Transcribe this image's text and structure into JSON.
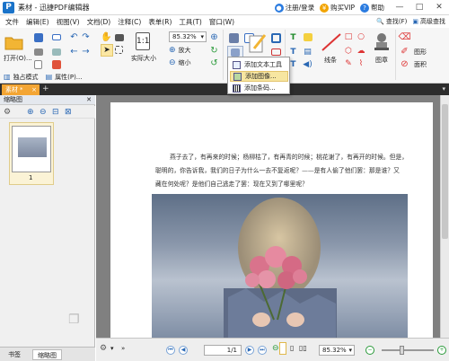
{
  "window": {
    "title": "素材 - 迅捷PDF编辑器",
    "logo_letter": "P"
  },
  "title_right": {
    "login": "注册/登录",
    "vip": "购买VIP",
    "help": "帮助",
    "colors": {
      "login": "#2a7be0",
      "vip": "#f2a400",
      "help": "#2a7be0"
    }
  },
  "menu": [
    "文件",
    "编辑(E)",
    "视图(V)",
    "文档(D)",
    "注释(C)",
    "表单(R)",
    "工具(T)",
    "窗口(W)"
  ],
  "menu_right": {
    "find": "查找(F)",
    "advanced_search": "高级查找"
  },
  "toolbar": {
    "open": "打开(O)...",
    "actual_size": "实际大小",
    "zoom_value": "85.32%",
    "zoom_in": "放大",
    "zoom_out": "缩小",
    "stamp": "图章",
    "line": "线条",
    "right_a": "图形",
    "right_b": "面积"
  },
  "subbar": {
    "exclusive_mode": "独占模式",
    "properties": "属性(P)..."
  },
  "dropdown": {
    "items": [
      "添加文本工具",
      "添加图像...",
      "添加条码..."
    ],
    "selected_index": 1
  },
  "tab": {
    "label": "素材",
    "close": "×"
  },
  "left_panel": {
    "title": "缩略图",
    "page_number": "1",
    "bottom_tabs": [
      "书签",
      "缩略图"
    ]
  },
  "document": {
    "line1": "燕子去了，有再来的时候；杨柳枯了，有再青的时候；桃花谢了，有再开的时候。但是，",
    "line2": "聪明的，你告诉我，我们的日子为什么一去不复返呢？——是有人偷了他们罢：那是谁？又",
    "line3": "藏在何处呢？是他们自己逃走了罢：现在又到了哪里呢？"
  },
  "statusbar": {
    "page": "1/1",
    "zoom": "85.32%"
  },
  "accent": {
    "tab": "#f3a534",
    "selected_item": "#f7e6a1",
    "logo": "#1a73c9"
  }
}
